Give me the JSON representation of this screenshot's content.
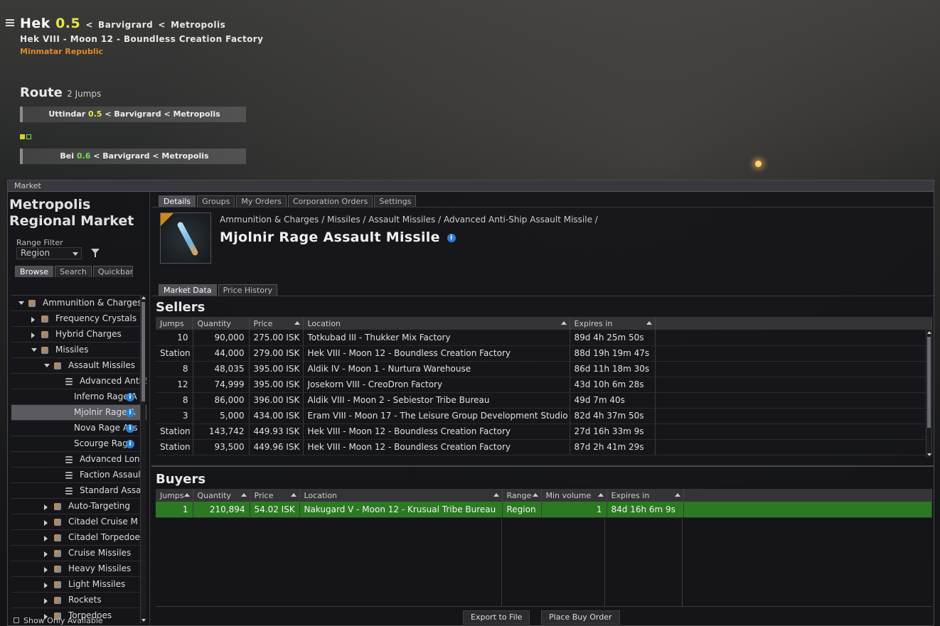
{
  "hud": {
    "system": "Hek",
    "security": "0.5",
    "constellation": "Barvigrard",
    "region": "Metropolis",
    "separator": "<",
    "station": "Hek VIII - Moon 12 - Boundless Creation Factory",
    "faction": "Minmatar Republic",
    "route_title": "Route",
    "route_jumps": "2 Jumps",
    "route_items": [
      {
        "system": "Uttindar",
        "security": "0.5",
        "constellation": "Barvigrard",
        "region": "Metropolis"
      },
      {
        "system": "Bei",
        "security": "0.6",
        "constellation": "Barvigrard",
        "region": "Metropolis"
      }
    ],
    "colors": {
      "sec05": "#e6e64a",
      "sec06": "#79e04a",
      "faction": "#e08a2a",
      "pip1": "#d4d42a",
      "pip2": "#79e04a"
    }
  },
  "window": {
    "title": "Market",
    "left": {
      "market_title": "Metropolis Regional Market",
      "range_filter_label": "Range Filter",
      "range_value": "Region",
      "tabs": [
        "Browse",
        "Search",
        "Quickbar"
      ],
      "tree": [
        {
          "label": "Ammunition & Charges",
          "level": 0,
          "expand": "down",
          "icon": "ammo-icon"
        },
        {
          "label": "Frequency Crystals",
          "level": 1,
          "expand": "right",
          "icon": "crystal-icon"
        },
        {
          "label": "Hybrid Charges",
          "level": 1,
          "expand": "right",
          "icon": "hybrid-icon"
        },
        {
          "label": "Missiles",
          "level": 1,
          "expand": "down",
          "icon": "missile-icon"
        },
        {
          "label": "Assault Missiles",
          "level": 2,
          "expand": "down",
          "icon": "missile-icon"
        },
        {
          "label": "Advanced Anti-Sh",
          "level": 3,
          "expand": "",
          "icon": "list-icon"
        },
        {
          "label": "Inferno Rage A",
          "level": 4,
          "expand": "",
          "icon": "",
          "info": true
        },
        {
          "label": "Mjolnir Rage A",
          "level": 4,
          "expand": "",
          "icon": "",
          "info": true,
          "selected": true
        },
        {
          "label": "Nova Rage Ass",
          "level": 4,
          "expand": "",
          "icon": "",
          "info": true
        },
        {
          "label": "Scourge Rage",
          "level": 4,
          "expand": "",
          "icon": "",
          "info": true
        },
        {
          "label": "Advanced Long R",
          "level": 3,
          "expand": "",
          "icon": "list-icon"
        },
        {
          "label": "Faction Assault M",
          "level": 3,
          "expand": "",
          "icon": "list-icon"
        },
        {
          "label": "Standard Assault",
          "level": 3,
          "expand": "",
          "icon": "list-icon"
        },
        {
          "label": "Auto-Targeting",
          "level": 2,
          "expand": "right",
          "icon": "missile-icon"
        },
        {
          "label": "Citadel Cruise M",
          "level": 2,
          "expand": "right",
          "icon": "missile-icon"
        },
        {
          "label": "Citadel Torpedoe",
          "level": 2,
          "expand": "right",
          "icon": "missile-icon"
        },
        {
          "label": "Cruise Missiles",
          "level": 2,
          "expand": "right",
          "icon": "missile-icon"
        },
        {
          "label": "Heavy Missiles",
          "level": 2,
          "expand": "right",
          "icon": "missile-icon"
        },
        {
          "label": "Light Missiles",
          "level": 2,
          "expand": "right",
          "icon": "missile-icon"
        },
        {
          "label": "Rockets",
          "level": 2,
          "expand": "right",
          "icon": "missile-icon"
        },
        {
          "label": "Torpedoes",
          "level": 2,
          "expand": "right",
          "icon": "missile-icon"
        }
      ],
      "show_only_available": "Show Only Available"
    },
    "right": {
      "tabs": [
        "Details",
        "Groups",
        "My Orders",
        "Corporation Orders",
        "Settings"
      ],
      "breadcrumb": "Ammunition & Charges / Missiles / Assault Missiles / Advanced Anti-Ship Assault Missile /",
      "item_name": "Mjolnir Rage Assault Missile",
      "subtabs": [
        "Market Data",
        "Price History"
      ],
      "sellers_title": "Sellers",
      "sellers_columns": [
        "Jumps",
        "Quantity",
        "Price",
        "Location",
        "Expires in"
      ],
      "sellers": [
        [
          "10",
          "90,000",
          "275.00 ISK",
          "Totkubad III - Thukker Mix Factory",
          "89d 4h 25m 50s"
        ],
        [
          "Station",
          "44,000",
          "279.00 ISK",
          "Hek VIII - Moon 12 - Boundless Creation Factory",
          "88d 19h 19m 47s"
        ],
        [
          "8",
          "48,035",
          "395.00 ISK",
          "Aldik IV - Moon 1 - Nurtura Warehouse",
          "86d 11h 18m 30s"
        ],
        [
          "12",
          "74,999",
          "395.00 ISK",
          "Josekorn VIII - CreoDron Factory",
          "43d 10h 6m 28s"
        ],
        [
          "8",
          "86,000",
          "396.00 ISK",
          "Aldik VIII - Moon 2 - Sebiestor Tribe Bureau",
          "49d 7m 40s"
        ],
        [
          "3",
          "5,000",
          "434.00 ISK",
          "Eram VIII - Moon 17 - The Leisure Group Development Studio",
          "82d 4h 37m 50s"
        ],
        [
          "Station",
          "143,742",
          "449.93 ISK",
          "Hek VIII - Moon 12 - Boundless Creation Factory",
          "27d 16h 33m 9s"
        ],
        [
          "Station",
          "93,500",
          "449.96 ISK",
          "Hek VIII - Moon 12 - Boundless Creation Factory",
          "87d 2h 41m 29s"
        ]
      ],
      "buyers_title": "Buyers",
      "buyers_columns": [
        "Jumps",
        "Quantity",
        "Price",
        "Location",
        "Range",
        "Min volume",
        "Expires in"
      ],
      "buyers": [
        [
          "1",
          "210,894",
          "54.02 ISK",
          "Nakugard V - Moon 12 - Krusual Tribe Bureau",
          "Region",
          "1",
          "84d 16h 6m 9s"
        ]
      ],
      "export_label": "Export to File",
      "buy_order_label": "Place Buy Order",
      "colors": {
        "buyer_row": "#2b7a22",
        "info": "#2d7fd8",
        "corner": "#d0881e"
      }
    }
  }
}
